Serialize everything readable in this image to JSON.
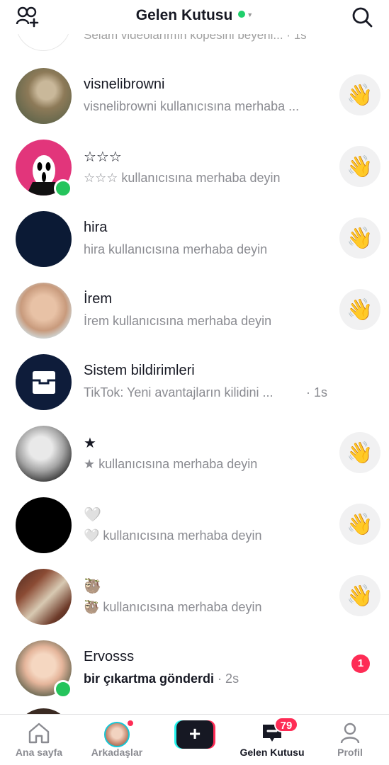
{
  "header": {
    "title": "Gelen Kutusu",
    "add_friend_icon": "add-friends-icon",
    "search_icon": "search-icon",
    "status_color": "#25c45c"
  },
  "partial_top": {
    "text": "Selam videolarımın kopesini beyeni... · 1s"
  },
  "rows": [
    {
      "name": "visnelibrowni",
      "sub": "visnelibrowni kullanıcısına merhaba ...",
      "action": "wave"
    },
    {
      "name": "☆☆☆",
      "sub": "☆☆☆ kullanıcısına merhaba deyin",
      "action": "wave",
      "online": true
    },
    {
      "name": "hira",
      "sub": "hira kullanıcısına merhaba deyin",
      "action": "wave"
    },
    {
      "name": "İrem",
      "sub": "İrem kullanıcısına merhaba deyin",
      "action": "wave"
    },
    {
      "name": "Sistem bildirimleri",
      "sub": "TikTok: Yeni avantajların kilidini ...",
      "time": "· 1s"
    },
    {
      "name": "★",
      "sub": "★ kullanıcısına merhaba deyin",
      "action": "wave"
    },
    {
      "name": "🤍",
      "sub": "🤍 kullanıcısına merhaba deyin",
      "action": "wave"
    },
    {
      "name": "🦥",
      "sub": "🦥 kullanıcısına merhaba deyin",
      "action": "wave"
    },
    {
      "name": "Ervosss",
      "sub": "bir çıkartma gönderdi",
      "time": "· 2s",
      "unread": "1",
      "online": true
    }
  ],
  "wave_emoji": "👋",
  "nav": {
    "home": "Ana sayfa",
    "friends": "Arkadaşlar",
    "create": "+",
    "inbox": "Gelen Kutusu",
    "inbox_badge": "79",
    "profile": "Profil"
  }
}
